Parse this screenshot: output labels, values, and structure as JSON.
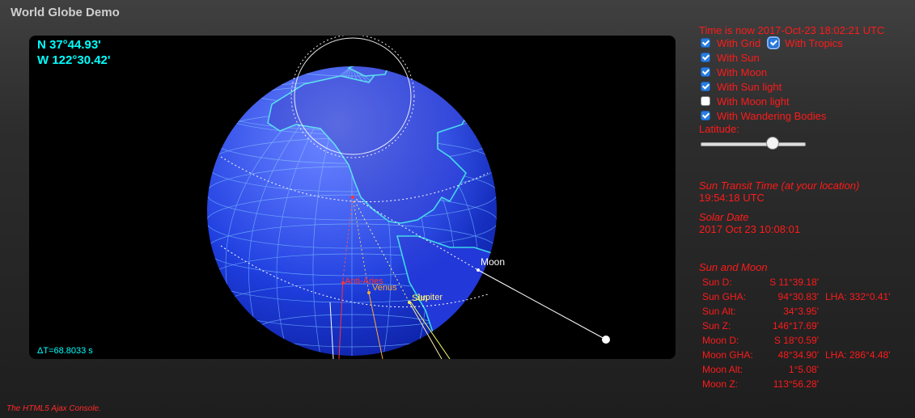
{
  "app": {
    "title": "World Globe Demo",
    "footer": "The HTML5 Ajax Console."
  },
  "position": {
    "latitude": "N 37°44.93'",
    "longitude": "W 122°30.42'",
    "delta_t": "ΔT=68.8033 s"
  },
  "time_now": "Time is now 2017-Oct-23 18:02:21 UTC",
  "options": [
    {
      "label": "With Grid",
      "checked": true
    },
    {
      "label": "With Tropics",
      "checked": true
    },
    {
      "label": "With Sun",
      "checked": true
    },
    {
      "label": "With Moon",
      "checked": true
    },
    {
      "label": "With Sun light",
      "checked": true
    },
    {
      "label": "With Moon light",
      "checked": false
    },
    {
      "label": "With Wandering Bodies",
      "checked": true
    }
  ],
  "latitude_slider": {
    "label": "Latitude:",
    "value_fraction": 0.68
  },
  "sun_transit": {
    "heading": "Sun Transit Time (at your location)",
    "value": "19:54:18 UTC"
  },
  "solar_date": {
    "heading": "Solar Date",
    "value": "2017 Oct 23 10:08:01"
  },
  "sun_moon": {
    "heading": "Sun and Moon",
    "rows": [
      {
        "label": "Sun D:",
        "value": "S 11°39.18'"
      },
      {
        "label": "Sun GHA:",
        "value": "94°30.83'",
        "lha": "LHA: 332°0.41'"
      },
      {
        "label": "Sun Alt:",
        "value": "34°3.95'"
      },
      {
        "label": "Sun Z:",
        "value": "146°17.69'"
      },
      {
        "label": "Moon D:",
        "value": "S 18°0.59'"
      },
      {
        "label": "Moon GHA:",
        "value": "48°34.90'",
        "lha": "LHA: 286°4.48'"
      },
      {
        "label": "Moon Alt:",
        "value": "1°5.08'"
      },
      {
        "label": "Moon Z:",
        "value": "113°56.28'"
      }
    ]
  },
  "globe_labels": {
    "moon": "Moon",
    "anti_aries": "Anti-Aries",
    "venus": "Venus",
    "jupiter": "Jupiter",
    "sun": "Sun"
  },
  "colors": {
    "panel_text": "#ff1a1a",
    "coord_text": "#00ffff",
    "ocean": "#1f3fe0",
    "land": "#3ad6e8",
    "grid": "#6fb0ff"
  }
}
